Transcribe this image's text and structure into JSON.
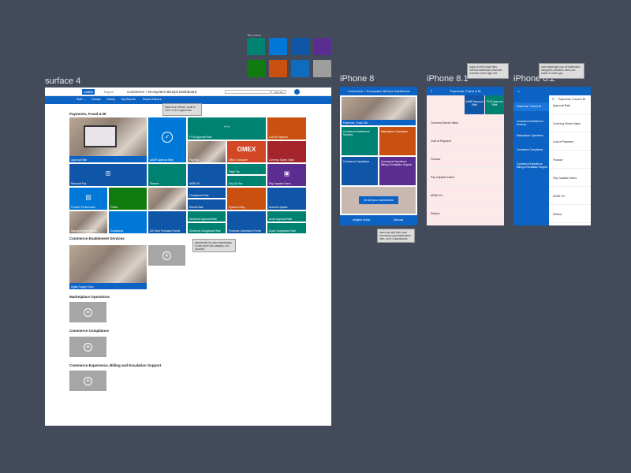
{
  "palette": {
    "title": "Tile colors",
    "swatches": [
      "#008272",
      "#0078d7",
      "#0f56a8",
      "#5c2d91",
      "#107c10",
      "#ca5010",
      "#0f6cbd",
      "#9e9e9e"
    ]
  },
  "surface": {
    "label": "surface 4",
    "logo": "LOGO",
    "report": "Report",
    "title": "Commerce + Ecosystem BizOps Dashboard",
    "select_value": "Submitter",
    "nav": [
      "Start ⌄",
      "Groups",
      "Library",
      "My Reports",
      "Report Authors"
    ],
    "sections": {
      "payments": "Payments, Fraud & BI",
      "enablement": "Commerce Enablement Services",
      "marketplace": "Marketplace Operations",
      "compliance": "Commerce Compliance",
      "experience": "Commerce Experience, Billing and Escalation Support"
    },
    "tiles": {
      "approval_rate": "Approval Rate",
      "aamp": "AAMP Approval Rate",
      "fy16": "FY16 Approval Rate",
      "cost_payment": "Cost of Payment",
      "pay_edu": "Pay Edu",
      "omex": "OMEX",
      "office_consumer": "Office Consumer",
      "currency": "Currency Stored Value",
      "microsoft_pay": "Microsoft Pay",
      "finance": "Finance",
      "mobi": "MOBI VG",
      "payin_tax": "Payin Tax",
      "payout_tax": "Pay-Out Tax",
      "pay_capable": "Pay Capable Users",
      "provider": "Provider Performance",
      "pi4m": "PI4Ms",
      "chargeback": "Chargeback Rate",
      "refund": "Refund Rate",
      "dynamic": "Dynamic Retry",
      "account": "Account Updater",
      "manual": "Manual Review Metrics",
      "escalations": "Escalations",
      "ms_store": "MS Store Purchase Funnel",
      "storefront_approval": "Storefront Approval Rate",
      "storefront_charge": "Storefront Chargeback Rate",
      "purchase_funnel": "Purchase Conversion Funnel",
      "azure_approval": "Azure Approval Rate",
      "azure_charge": "Azure Chargeback Rate",
      "digital_supply": "Digital Supply Chain"
    },
    "note1": "Mast hover effects: scale to 120% of it's original size",
    "note2": "placeholder for more dashboards to add under this category, not clickable",
    "plus": "+"
  },
  "phone1": {
    "label": "iPhone 8",
    "bar_title": "Commerce + Ecosystem BizOps Dashboard",
    "tiles": [
      "Payments, Fraud & BI",
      "Commerce Enablement Services",
      "Marketplace Operations",
      "Commerce Compliance",
      "Commerce Experience, Billing & Escalation Support"
    ],
    "add_label": "Add your dashboards",
    "footer_left": "Insights Home",
    "footer_right": "Discuss",
    "note": "users can add their most commonly used dashboards here, up to 3 dashboards"
  },
  "phone2": {
    "label": "iPhone 8.1",
    "bar_title": "Payments, Fraud & BI",
    "col1": "AAMP Approval Rate",
    "col2": "FY16 Approval Rate",
    "rows": [
      "Currency Stored Value",
      "Cost of Payment",
      "Finance",
      "Pay Capable Users",
      "MOBI VG",
      "Refund"
    ],
    "note": "swipe to left to each item, relevant dashboard shortcuts revealed on the right end"
  },
  "phone3": {
    "label": "iPhone 8.2",
    "bar_title": "Payments, Fraud & BI",
    "menu": [
      "Payments, Fraud & BI",
      "Commerce Enablement Services",
      "Marketplace Operations",
      "Commerce Compliance",
      "Commerce Experience, Billing & Escalation Support"
    ],
    "rows": [
      "Approval Rate",
      "Currency Stored Value",
      "Cost of Payment",
      "Finance",
      "Pay Capable Users",
      "MOBI VG",
      "Refund"
    ],
    "note": "click hamburger icon all dashboard categories unfolded; users can switch to other type"
  }
}
